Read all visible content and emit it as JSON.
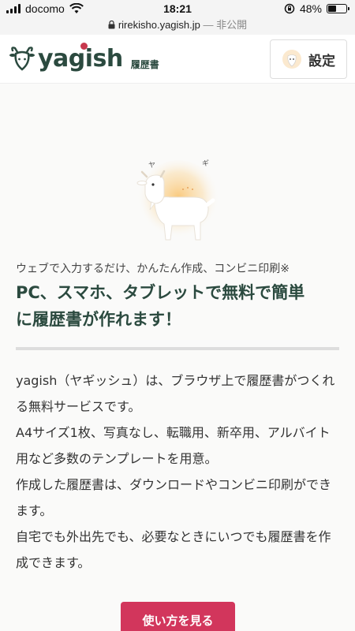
{
  "status_bar": {
    "carrier": "docomo",
    "time": "18:21",
    "battery": "48%",
    "battery_level": 0.48
  },
  "url_bar": {
    "domain": "rirekisho.yagish.jp",
    "suffix": "— 非公開"
  },
  "header": {
    "logo_text": "yagish",
    "logo_subtitle": "履歴書",
    "settings_label": "設定"
  },
  "hero": {
    "goat_label_left": "ヤ",
    "goat_label_right": "ギ"
  },
  "main": {
    "tagline": "ウェブで入力するだけ、かんたん作成、コンビニ印刷※",
    "headline_line1": "PC、スマホ、タブレットで無料で簡単",
    "headline_line2": "に履歴書が作れます！",
    "description": [
      "yagish（ヤギッシュ）は、ブラウザ上で履歴書がつくれる無料サービスです。",
      "A4サイズ1枚、写真なし、転職用、新卒用、アルバイト用など多数のテンプレートを用意。",
      "作成した履歴書は、ダウンロードやコンビニ印刷ができます。",
      "自宅でも外出先でも、必要なときにいつでも履歴書を作成できます。"
    ],
    "cta_label": "使い方を見る"
  },
  "colors": {
    "brand_green": "#2b4a3f",
    "cta_pink": "#d2365c",
    "accent_red": "#c8394e"
  }
}
